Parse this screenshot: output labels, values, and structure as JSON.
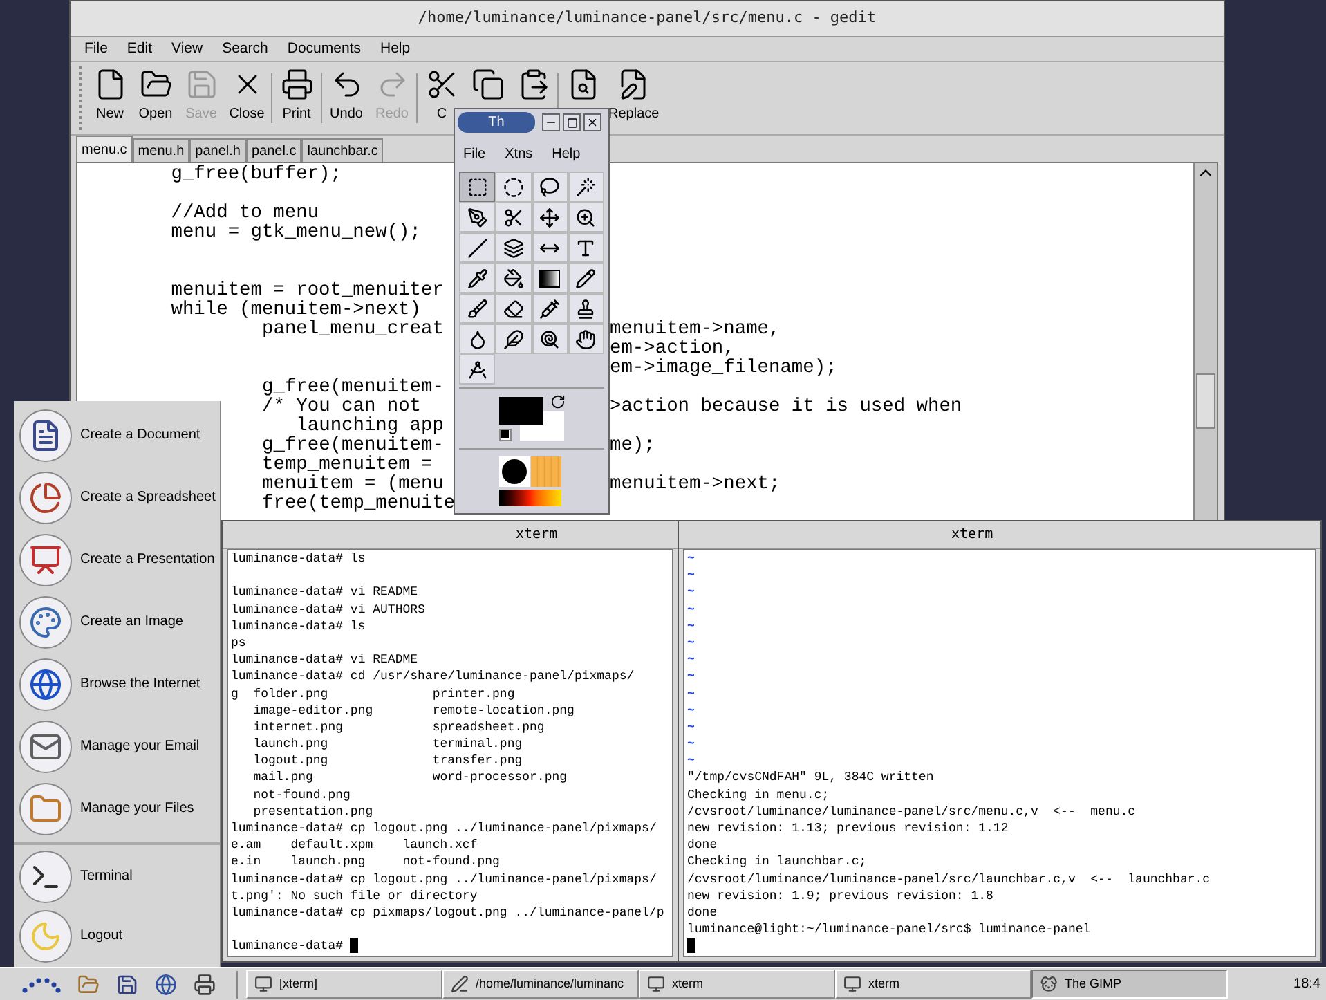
{
  "gedit": {
    "title": "/home/luminance/luminance-panel/src/menu.c - gedit",
    "menu": [
      "File",
      "Edit",
      "View",
      "Search",
      "Documents",
      "Help"
    ],
    "toolbar": [
      [
        {
          "label": "New",
          "disabled": false
        },
        {
          "label": "Open",
          "disabled": false
        },
        {
          "label": "Save",
          "disabled": true
        },
        {
          "label": "Close",
          "disabled": false
        }
      ],
      [
        {
          "label": "Print",
          "disabled": false
        }
      ],
      [
        {
          "label": "Undo",
          "disabled": false
        },
        {
          "label": "Redo",
          "disabled": true
        }
      ],
      [
        {
          "label": "C",
          "disabled": false
        },
        {
          "disabled": false
        },
        {
          "disabled": false
        }
      ],
      [
        {
          "disabled": false
        },
        {
          "label": "Replace",
          "disabled": false
        }
      ]
    ],
    "tabs": [
      {
        "label": "menu.c",
        "selected": true
      },
      {
        "label": "menu.h",
        "selected": false
      },
      {
        "label": "panel.h",
        "selected": false
      },
      {
        "label": "panel.c",
        "selected": false
      },
      {
        "label": "launchbar.c",
        "selected": false
      }
    ],
    "code": [
      {
        "kind": "code",
        "left": "        g_free(buffer);"
      },
      {
        "kind": "blank"
      },
      {
        "kind": "code",
        "left": "        //Add to menu"
      },
      {
        "kind": "code",
        "left": "        menu = gtk_menu_new();"
      },
      {
        "kind": "blank"
      },
      {
        "kind": "blank"
      },
      {
        "kind": "code",
        "left": "        menuitem = root_menuiter"
      },
      {
        "kind": "code",
        "left": "        while (menuitem->next)"
      },
      {
        "kind": "code",
        "left": "                panel_menu_creat",
        "right": "menuitem->name,"
      },
      {
        "kind": "code",
        "right": "em->action,"
      },
      {
        "kind": "code",
        "right": "em->image_filename);"
      },
      {
        "kind": "code",
        "left": "                g_free(menuitem-"
      },
      {
        "kind": "code",
        "left": "                /* You can not",
        "right": ">action because it is used when"
      },
      {
        "kind": "code",
        "left": "                   launching app"
      },
      {
        "kind": "code",
        "left": "                g_free(menuitem-",
        "right": "me);"
      },
      {
        "kind": "code",
        "left": "                temp_menuitem ="
      },
      {
        "kind": "code",
        "left": "                menuitem = (menu",
        "right": "menuitem->next;"
      },
      {
        "kind": "code",
        "left": "                free(temp_menuite"
      }
    ]
  },
  "gimp": {
    "title": "Th",
    "menu": [
      "File",
      "Xtns",
      "Help"
    ],
    "tools": [
      {
        "selected": true
      },
      {
        "selected": false
      },
      {
        "selected": false
      },
      {
        "selected": false
      },
      {
        "selected": false
      },
      {
        "selected": false
      },
      {
        "selected": false
      },
      {
        "selected": false
      },
      {
        "selected": false
      },
      {
        "selected": false
      },
      {
        "selected": false
      },
      {
        "selected": false
      },
      {
        "selected": false
      },
      {
        "selected": false
      },
      {
        "selected": false
      },
      {
        "selected": false
      },
      {
        "selected": false
      },
      {
        "selected": false
      },
      {
        "selected": false
      },
      {
        "selected": false
      },
      {
        "selected": false
      },
      {
        "selected": false
      },
      {
        "selected": false
      },
      {
        "selected": false
      },
      {
        "selected": false
      }
    ]
  },
  "launcher": {
    "sections": [
      {
        "items": [
          {
            "label": "Create a Document"
          },
          {
            "label": "Create a Spreadsheet"
          },
          {
            "label": "Create a Presentation"
          },
          {
            "label": "Create an Image"
          },
          {
            "label": "Browse the Internet"
          },
          {
            "label": "Manage your Email"
          },
          {
            "label": "Manage your Files"
          }
        ]
      },
      {
        "items": [
          {
            "label": "Terminal"
          },
          {
            "label": "Logout"
          }
        ]
      }
    ]
  },
  "xterm_left": {
    "title": "xterm",
    "cursor": true,
    "lines": [
      {
        "kind": "text",
        "text": "luminance-data# ls"
      },
      {
        "kind": "blank"
      },
      {
        "kind": "text",
        "text": "luminance-data# vi README"
      },
      {
        "kind": "text",
        "text": "luminance-data# vi AUTHORS"
      },
      {
        "kind": "text",
        "text": "luminance-data# ls"
      },
      {
        "kind": "text",
        "text": "ps"
      },
      {
        "kind": "text",
        "text": "luminance-data# vi README"
      },
      {
        "kind": "text",
        "text": "luminance-data# cd /usr/share/luminance-panel/pixmaps/"
      },
      {
        "kind": "text",
        "text": "g  folder.png              printer.png"
      },
      {
        "kind": "text",
        "text": "   image-editor.png        remote-location.png"
      },
      {
        "kind": "text",
        "text": "   internet.png            spreadsheet.png"
      },
      {
        "kind": "text",
        "text": "   launch.png              terminal.png"
      },
      {
        "kind": "text",
        "text": "   logout.png              transfer.png"
      },
      {
        "kind": "text",
        "text": "   mail.png                word-processor.png"
      },
      {
        "kind": "text",
        "text": "   not-found.png"
      },
      {
        "kind": "text",
        "text": "   presentation.png"
      },
      {
        "kind": "text",
        "text": "luminance-data# cp logout.png ../luminance-panel/pixmaps/"
      },
      {
        "kind": "text",
        "text": "e.am    default.xpm    launch.xcf"
      },
      {
        "kind": "text",
        "text": "e.in    launch.png     not-found.png"
      },
      {
        "kind": "text",
        "text": "luminance-data# cp logout.png ../luminance-panel/pixmaps/"
      },
      {
        "kind": "text",
        "text": "t.png': No such file or directory"
      },
      {
        "kind": "text",
        "text": "luminance-data# cp pixmaps/logout.png ../luminance-panel/p"
      },
      {
        "kind": "blank"
      },
      {
        "kind": "text",
        "text": "luminance-data# "
      }
    ]
  },
  "xterm_right": {
    "title": "xterm",
    "cursor": true,
    "lines": [
      {
        "kind": "tilde",
        "text": "~"
      },
      {
        "kind": "tilde",
        "text": "~"
      },
      {
        "kind": "tilde",
        "text": "~"
      },
      {
        "kind": "tilde",
        "text": "~"
      },
      {
        "kind": "tilde",
        "text": "~"
      },
      {
        "kind": "tilde",
        "text": "~"
      },
      {
        "kind": "tilde",
        "text": "~"
      },
      {
        "kind": "tilde",
        "text": "~"
      },
      {
        "kind": "tilde",
        "text": "~"
      },
      {
        "kind": "tilde",
        "text": "~"
      },
      {
        "kind": "tilde",
        "text": "~"
      },
      {
        "kind": "tilde",
        "text": "~"
      },
      {
        "kind": "tilde",
        "text": "~"
      },
      {
        "kind": "text",
        "text": "\"/tmp/cvsCNdFAH\" 9L, 384C written"
      },
      {
        "kind": "text",
        "text": "Checking in menu.c;"
      },
      {
        "kind": "text",
        "text": "/cvsroot/luminance/luminance-panel/src/menu.c,v  <--  menu.c"
      },
      {
        "kind": "text",
        "text": "new revision: 1.13; previous revision: 1.12"
      },
      {
        "kind": "text",
        "text": "done"
      },
      {
        "kind": "text",
        "text": "Checking in launchbar.c;"
      },
      {
        "kind": "text",
        "text": "/cvsroot/luminance/luminance-panel/src/launchbar.c,v  <--  launchbar.c"
      },
      {
        "kind": "text",
        "text": "new revision: 1.9; previous revision: 1.8"
      },
      {
        "kind": "text",
        "text": "done"
      },
      {
        "kind": "text",
        "text": "luminance@light:~/luminance-panel/src$ luminance-panel"
      },
      {
        "kind": "blank"
      }
    ]
  },
  "taskbar": {
    "tasks": [
      {
        "kind": "terminal",
        "label": "[xterm]",
        "selected": false
      },
      {
        "kind": "editor",
        "label": "/home/luminance/luminanc",
        "selected": false
      },
      {
        "kind": "terminal",
        "label": "xterm",
        "selected": false
      },
      {
        "kind": "terminal",
        "label": "xterm",
        "selected": false
      },
      {
        "kind": "gimp",
        "label": "The GIMP",
        "selected": true
      }
    ],
    "clock": "18:4"
  }
}
